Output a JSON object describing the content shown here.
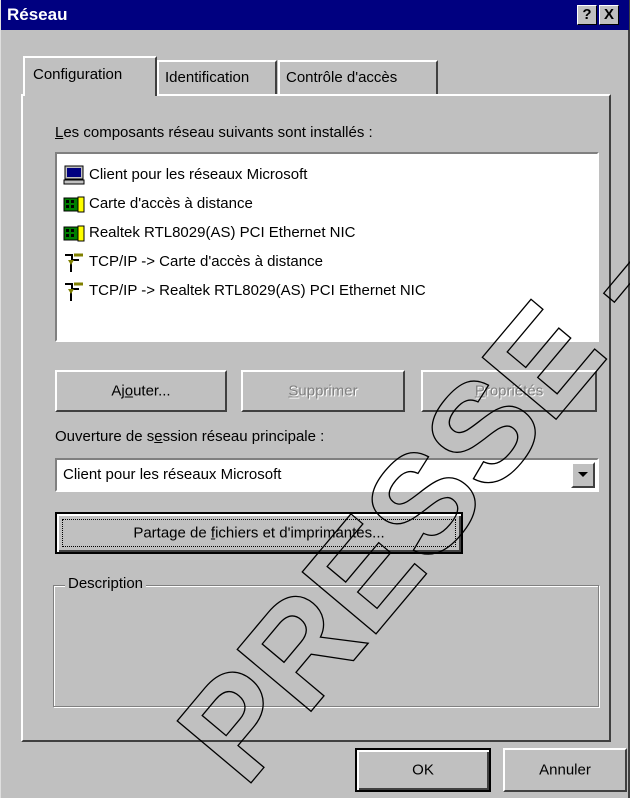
{
  "window": {
    "title": "Réseau",
    "help_glyph": "?",
    "close_glyph": "X"
  },
  "tabs": [
    {
      "label": "Configuration",
      "active": true
    },
    {
      "label": "Identification",
      "active": false
    },
    {
      "label": "Contrôle d'accès",
      "active": false
    }
  ],
  "components": {
    "label_prefix": "L",
    "label_rest": "es composants réseau suivants sont installés :",
    "items": [
      {
        "label": "Client pour les réseaux Microsoft",
        "icon": "computer-icon"
      },
      {
        "label": "Carte d'accès à distance",
        "icon": "network-card-icon"
      },
      {
        "label": "Realtek RTL8029(AS) PCI Ethernet NIC",
        "icon": "network-card-icon"
      },
      {
        "label": "TCP/IP -> Carte d'accès à distance",
        "icon": "protocol-icon"
      },
      {
        "label": "TCP/IP -> Realtek RTL8029(AS) PCI Ethernet NIC",
        "icon": "protocol-icon"
      }
    ]
  },
  "buttons": {
    "add": {
      "pre": "Aj",
      "accel": "o",
      "post": "uter..."
    },
    "remove": {
      "accel": "S",
      "post": "upprimer"
    },
    "properties": {
      "accel": "P",
      "post": "ropriétés"
    }
  },
  "logon": {
    "label_pre": "Ouverture de s",
    "label_accel": "e",
    "label_post": "ssion réseau principale :",
    "selected": "Client pour les réseaux Microsoft"
  },
  "sharing_button": {
    "pre": "Partage de ",
    "accel": "f",
    "post": "ichiers et d'imprimantes..."
  },
  "description": {
    "title": "Description"
  },
  "footer": {
    "ok": "OK",
    "cancel": "Annuler"
  },
  "watermark": {
    "text": "PRESSE – LP"
  },
  "colors": {
    "titlebar": "#000080",
    "face": "#c0c0c0",
    "watermark": "#000000"
  }
}
